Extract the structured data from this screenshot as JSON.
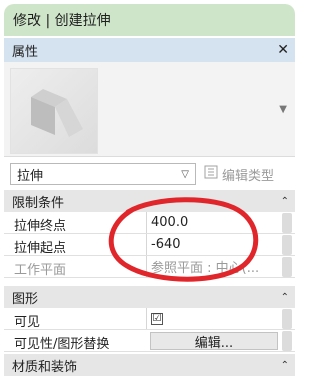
{
  "window": {
    "title": "修改 | 创建拉伸"
  },
  "properties": {
    "header": "属性",
    "type_selector": {
      "value": "拉伸"
    },
    "edit_type_label": "编辑类型",
    "sections": [
      {
        "label": "限制条件",
        "rows": [
          {
            "label": "拉伸终点",
            "value": "400.0"
          },
          {
            "label": "拉伸起点",
            "value": "-640"
          },
          {
            "label": "工作平面",
            "value": "参照平面 : 中心(..."
          }
        ]
      },
      {
        "label": "图形",
        "rows": [
          {
            "label": "可见",
            "value": "☑"
          },
          {
            "label": "可见性/图形替换",
            "value": "编辑..."
          }
        ]
      },
      {
        "label": "材质和装饰",
        "rows": []
      }
    ]
  },
  "icons": {
    "close": "close-icon",
    "preview_dropdown": "chevron-down-icon",
    "type_dropdown": "chevron-down-icon",
    "edit_type": "edit-type-icon",
    "collapse": "collapse-icon"
  },
  "colors": {
    "title_bg": "#cfe5c9",
    "header_bg": "#d5e2f0",
    "section_bg": "#e6e6e6",
    "annotation_red": "#e0262a"
  }
}
